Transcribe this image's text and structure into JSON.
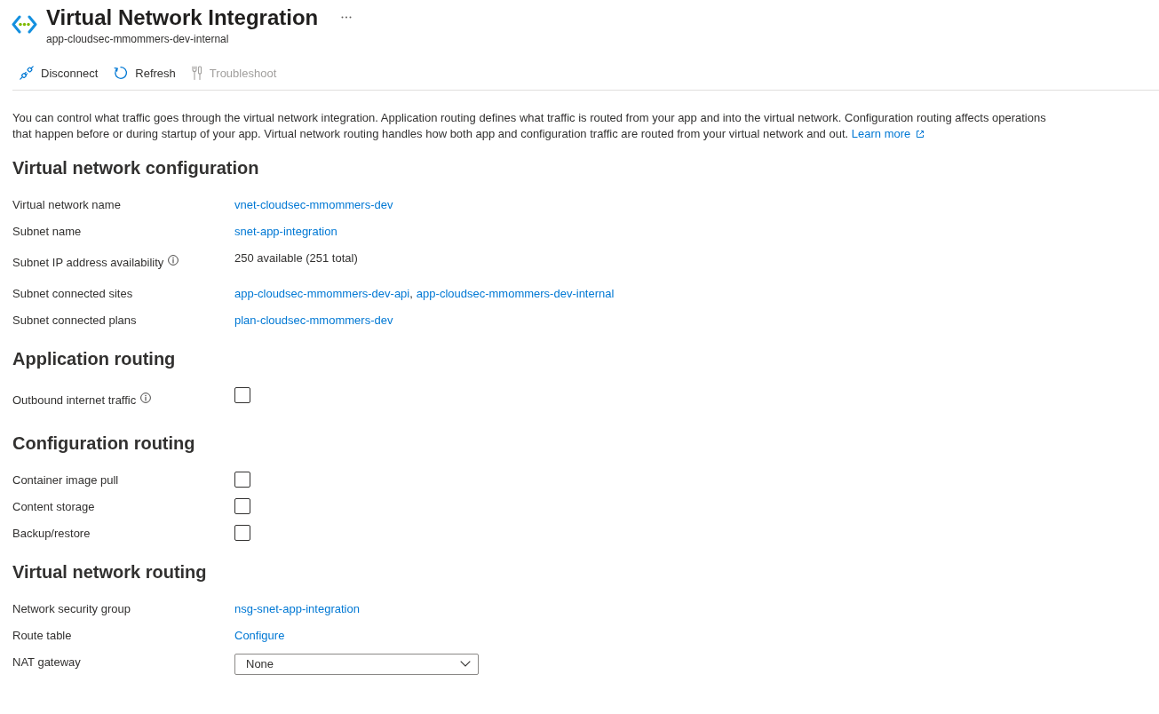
{
  "header": {
    "title": "Virtual Network Integration",
    "subtitle": "app-cloudsec-mmommers-dev-internal"
  },
  "toolbar": [
    {
      "label": "Disconnect",
      "kind": "disconnect",
      "disabled": false
    },
    {
      "label": "Refresh",
      "kind": "refresh",
      "disabled": false
    },
    {
      "label": "Troubleshoot",
      "kind": "troubleshoot",
      "disabled": true
    }
  ],
  "intro": {
    "text": "You can control what traffic goes through the virtual network integration. Application routing defines what traffic is routed from your app and into the virtual network. Configuration routing affects operations that happen before or during startup of your app. Virtual network routing handles how both app and configuration traffic are routed from your virtual network and out.",
    "link": "Learn more"
  },
  "sections": [
    {
      "title": "Virtual network configuration",
      "rows": [
        {
          "label": "Virtual network name",
          "kind": "links",
          "info": false,
          "links": [
            "vnet-cloudsec-mmommers-dev"
          ]
        },
        {
          "label": "Subnet name",
          "kind": "links",
          "info": false,
          "links": [
            "snet-app-integration"
          ]
        },
        {
          "label": "Subnet IP address availability",
          "kind": "text",
          "info": true,
          "value": "250 available (251 total)"
        },
        {
          "label": "Subnet connected sites",
          "kind": "links",
          "info": false,
          "links": [
            "app-cloudsec-mmommers-dev-api",
            "app-cloudsec-mmommers-dev-internal"
          ],
          "separator": ","
        },
        {
          "label": "Subnet connected plans",
          "kind": "links",
          "info": false,
          "links": [
            "plan-cloudsec-mmommers-dev"
          ]
        }
      ]
    },
    {
      "title": "Application routing",
      "rows": [
        {
          "label": "Outbound internet traffic",
          "kind": "checkbox",
          "info": true,
          "checked": false
        }
      ]
    },
    {
      "title": "Configuration routing",
      "rows": [
        {
          "label": "Container image pull",
          "kind": "checkbox",
          "info": false,
          "checked": false
        },
        {
          "label": "Content storage",
          "kind": "checkbox",
          "info": false,
          "checked": false
        },
        {
          "label": "Backup/restore",
          "kind": "checkbox",
          "info": false,
          "checked": false
        }
      ]
    },
    {
      "title": "Virtual network routing",
      "rows": [
        {
          "label": "Network security group",
          "kind": "links",
          "info": false,
          "links": [
            "nsg-snet-app-integration"
          ]
        },
        {
          "label": "Route table",
          "kind": "links",
          "info": false,
          "links": [
            "Configure"
          ]
        },
        {
          "label": "NAT gateway",
          "kind": "dropdown",
          "info": false,
          "value": "None"
        }
      ]
    }
  ]
}
